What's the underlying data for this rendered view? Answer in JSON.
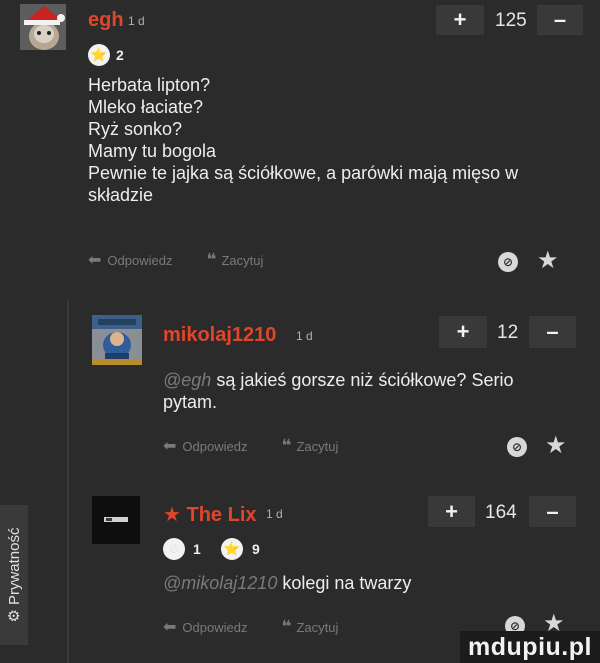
{
  "comments": [
    {
      "author": "egh",
      "time": "1 d",
      "score": "125",
      "vote_up": "+",
      "vote_down": "–",
      "badges": [
        {
          "icon": "star-badge-icon",
          "count": "2"
        }
      ],
      "lines": [
        "Herbata lipton?",
        "Mleko łaciate?",
        "Ryż sonko?",
        "Mamy tu bogola",
        "Pewnie te jajka są ściółkowe, a parówki mają mięso w",
        "składzie"
      ],
      "actions": {
        "reply": "Odpowiedz",
        "quote": "Zacytuj"
      }
    },
    {
      "author": "mikolaj1210",
      "time": "1 d",
      "score": "12",
      "vote_up": "+",
      "vote_down": "–",
      "mention": "@egh",
      "text_line1": "są jakieś gorsze niż ściółkowe? Serio",
      "text_line2": "pytam.",
      "actions": {
        "reply": "Odpowiedz",
        "quote": "Zacytuj"
      }
    },
    {
      "author": "The Lix",
      "author_prefix": "★",
      "time": "1 d",
      "score": "164",
      "vote_up": "+",
      "vote_down": "–",
      "badges": [
        {
          "icon": "circle-badge-icon",
          "count": "1"
        },
        {
          "icon": "star-badge-icon",
          "count": "9"
        }
      ],
      "mention": "@mikolaj1210",
      "text": "kolegi na twarzy",
      "actions": {
        "reply": "Odpowiedz",
        "quote": "Zacytuj"
      }
    }
  ],
  "sidebar": {
    "label": "Prywatność"
  },
  "watermark": "mdupiu.pl",
  "colors": {
    "background": "#2b2b2b",
    "author": "#e0462c",
    "button": "#393939",
    "muted": "#7a7a7a"
  }
}
